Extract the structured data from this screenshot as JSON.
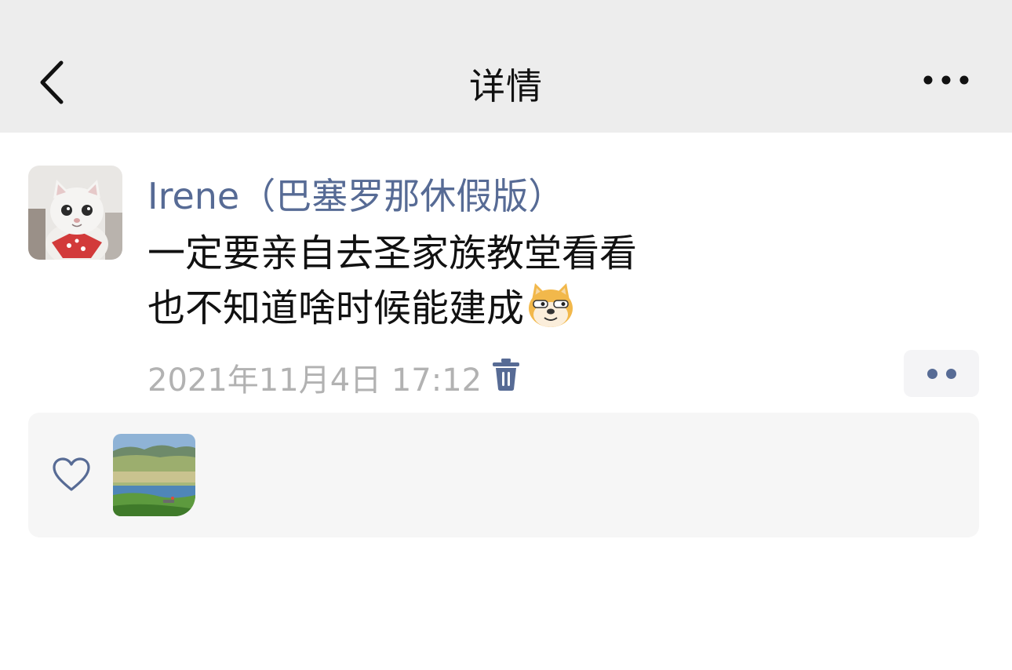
{
  "header": {
    "title": "详情",
    "back_icon": "chevron-left-icon",
    "more_icon": "more-dots-icon"
  },
  "post": {
    "author": "Irene（巴塞罗那休假版）",
    "text_lines": [
      "一定要亲自去圣家族教堂看看",
      "也不知道啥时候能建成"
    ],
    "emoji": "dog-face-emoji",
    "timestamp": "2021年11月4日 17:12",
    "delete_icon": "trash-icon",
    "action_icon": "two-dots-icon"
  },
  "likes": {
    "icon": "heart-outline-icon",
    "likers": [
      "landscape-avatar"
    ]
  },
  "colors": {
    "header_bg": "#ededed",
    "link_blue": "#576b95",
    "text": "#111111",
    "meta_gray": "#b2b2b2",
    "panel_bg": "#f6f6f6"
  }
}
